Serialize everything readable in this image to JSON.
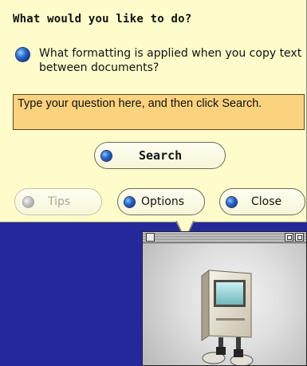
{
  "balloon": {
    "title": "What would you like to do?",
    "suggestion": "What formatting is applied when you copy text between documents?",
    "question_value": "Type your question here, and then click Search."
  },
  "buttons": {
    "search": "Search",
    "tips": "Tips",
    "options": "Options",
    "close": "Close"
  },
  "states": {
    "tips_disabled": true
  },
  "colors": {
    "desktop_background": "#24289a",
    "balloon_background": "#fdfcca",
    "question_background": "#fbd27d",
    "bullet_blue": "#2f73d8"
  },
  "icons": {
    "suggestion_bullet": "blue-bullet-icon",
    "assistant_character": "classic-mac-computer-character"
  }
}
